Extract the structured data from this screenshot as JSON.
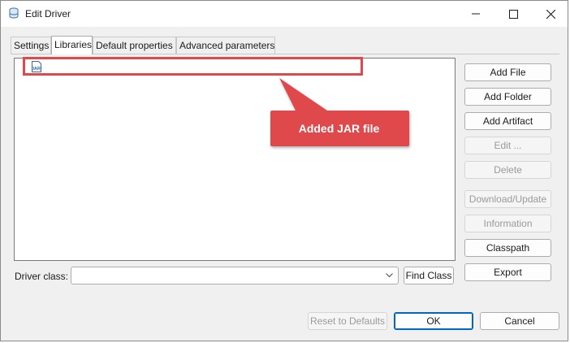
{
  "window": {
    "title": "Edit Driver"
  },
  "tabs": [
    {
      "label": "Settings"
    },
    {
      "label": "Libraries"
    },
    {
      "label": "Default properties"
    },
    {
      "label": "Advanced parameters"
    }
  ],
  "libraries": [
    {
      "icon": "jar-file-icon",
      "label": "JAR"
    }
  ],
  "callout": {
    "text": "Added JAR file",
    "color": "#e0494b"
  },
  "side_buttons": {
    "add_file": "Add File",
    "add_folder": "Add Folder",
    "add_artifact": "Add Artifact",
    "edit": "Edit ...",
    "delete": "Delete",
    "download_update": "Download/Update",
    "information": "Information",
    "classpath": "Classpath",
    "export": "Export"
  },
  "driver_class": {
    "label": "Driver class:",
    "value": "",
    "find_label": "Find Class"
  },
  "footer": {
    "reset": "Reset to Defaults",
    "ok": "OK",
    "cancel": "Cancel"
  }
}
